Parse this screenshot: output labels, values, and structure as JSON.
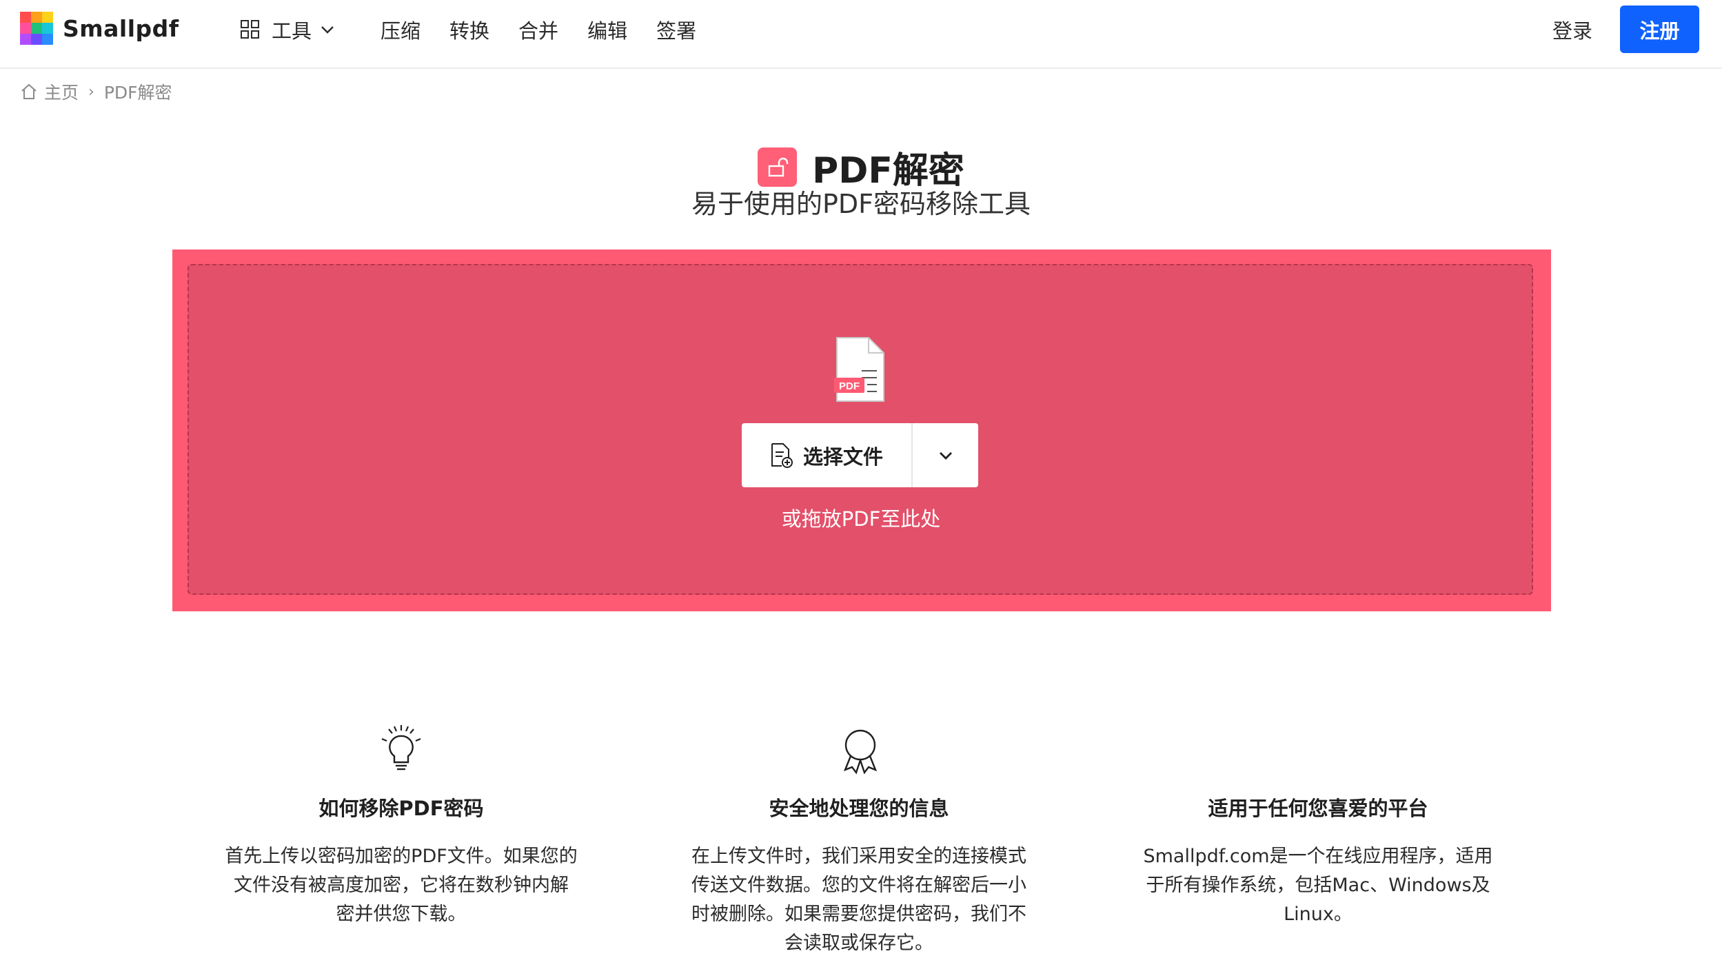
{
  "header": {
    "brand": "Smallpdf",
    "tools_label": "工具",
    "nav": [
      "压缩",
      "转换",
      "合并",
      "编辑",
      "签署"
    ],
    "login": "登录",
    "signup": "注册"
  },
  "breadcrumb": {
    "home": "主页",
    "separator": "›",
    "current": "PDF解密"
  },
  "page": {
    "title": "PDF解密",
    "subtitle": "易于使用的PDF密码移除工具"
  },
  "dropzone": {
    "file_badge": "PDF",
    "choose_label": "选择文件",
    "hint": "或拖放PDF至此处"
  },
  "features": [
    {
      "icon": "lightbulb-icon",
      "title": "如何移除PDF密码",
      "lines": [
        "首先上传以密码加密的PDF文件。如果您的",
        "文件没有被高度加密，它将在数秒钟内解",
        "密并供您下载。"
      ]
    },
    {
      "icon": "award-badge-icon",
      "title": "安全地处理您的信息",
      "lines": [
        "在上传文件时，我们采用安全的连接模式",
        "传送文件数据。您的文件将在解密后一小",
        "时被删除。如果需要您提供密码，我们不",
        "会读取或保存它。"
      ]
    },
    {
      "icon": "",
      "title": "适用于任何您喜爱的平台",
      "lines": [
        "Smallpdf.com是一个在线应用程序，适用",
        "于所有操作系统，包括Mac、Windows及",
        "Linux。"
      ]
    }
  ],
  "colors": {
    "accent": "#0f62fe",
    "dropzone_outer": "#ff5a74",
    "dropzone_inner": "#e3506a",
    "title_icon": "#ff5f77"
  }
}
